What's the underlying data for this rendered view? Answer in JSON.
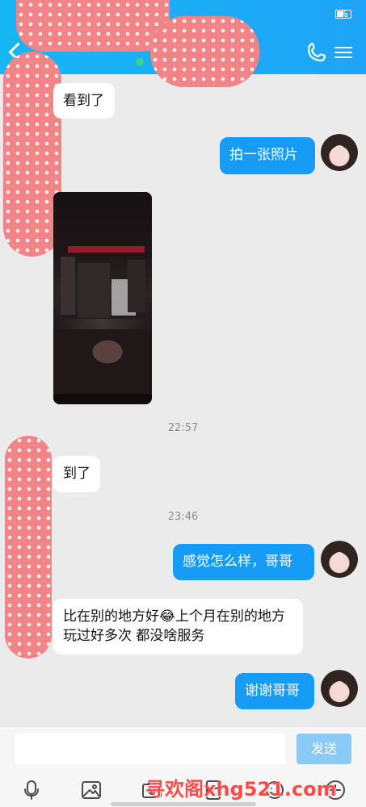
{
  "header": {
    "status_text": "%"
  },
  "messages": [
    {
      "text": "看到了"
    },
    {
      "text": "拍一张照片"
    },
    {
      "text": "到了"
    },
    {
      "text": "感觉怎么样，哥哥"
    },
    {
      "text": "比在别的地方好😂上个月在别的地方玩过好多次 都没啥服务"
    },
    {
      "text": "谢谢哥哥"
    }
  ],
  "timestamps": [
    "22:57",
    "23:46"
  ],
  "input": {
    "send_label": "发送"
  },
  "watermark": "寻欢阁xhg521.com"
}
